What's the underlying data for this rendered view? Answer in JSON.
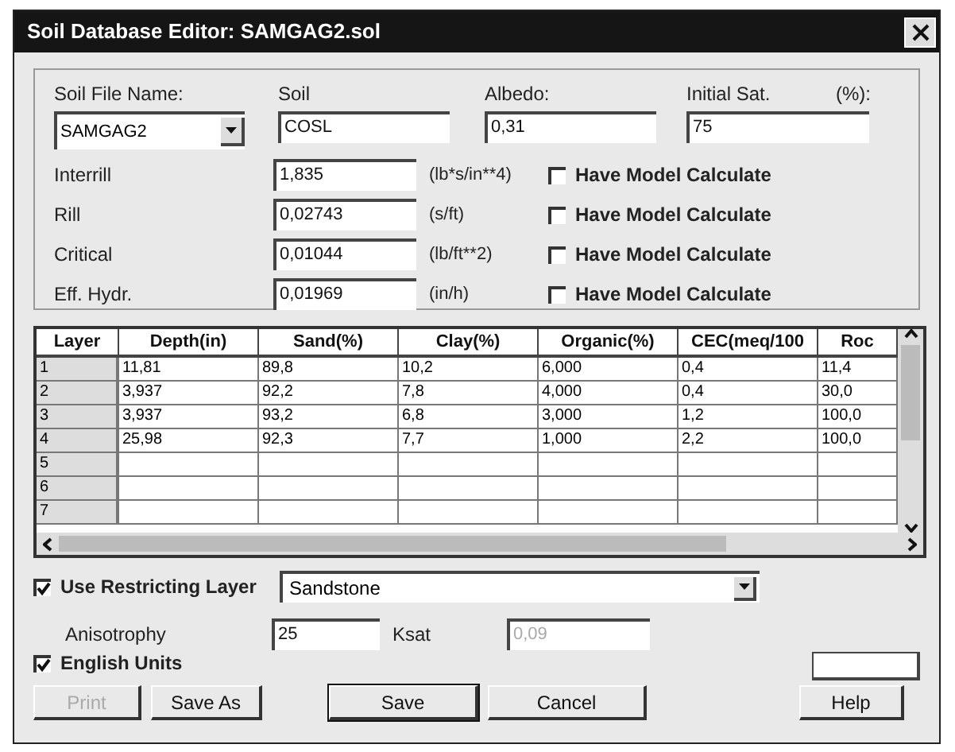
{
  "window": {
    "title": "Soil Database Editor: SAMGAG2.sol"
  },
  "header_fields": [
    {
      "label": "Soil File Name:",
      "value": "SAMGAG2",
      "kind": "dropdown"
    },
    {
      "label": "Soil",
      "value": "COSL",
      "kind": "text"
    },
    {
      "label": "Albedo:",
      "value": "0,31",
      "kind": "text"
    },
    {
      "label": "Initial Sat.",
      "unit": "(%):",
      "value": "75",
      "kind": "text"
    }
  ],
  "parameters": [
    {
      "label": "Interrill",
      "value": "1,835",
      "unit": "(lb*s/in**4)",
      "checkbox": "Have Model Calculate",
      "checked": false
    },
    {
      "label": "Rill",
      "value": "0,02743",
      "unit": "(s/ft)",
      "checkbox": "Have Model Calculate",
      "checked": false
    },
    {
      "label": "Critical",
      "value": "0,01044",
      "unit": "(lb/ft**2)",
      "checkbox": "Have Model Calculate",
      "checked": false
    },
    {
      "label": "Eff. Hydr.",
      "value": "0,01969",
      "unit": "(in/h)",
      "checkbox": "Have Model Calculate",
      "checked": false
    }
  ],
  "table": {
    "columns": [
      "Layer",
      "Depth(in)",
      "Sand(%)",
      "Clay(%)",
      "Organic(%)",
      "CEC(meq/100",
      "Roc"
    ],
    "rows": [
      [
        "1",
        "11,81",
        "89,8",
        "10,2",
        "6,000",
        "0,4",
        "11,4"
      ],
      [
        "2",
        "3,937",
        "92,2",
        "7,8",
        "4,000",
        "0,4",
        "30,0"
      ],
      [
        "3",
        "3,937",
        "93,2",
        "6,8",
        "3,000",
        "1,2",
        "100,0"
      ],
      [
        "4",
        "25,98",
        "92,3",
        "7,7",
        "1,000",
        "2,2",
        "100,0"
      ],
      [
        "5",
        "",
        "",
        "",
        "",
        "",
        ""
      ],
      [
        "6",
        "",
        "",
        "",
        "",
        "",
        ""
      ],
      [
        "7",
        "",
        "",
        "",
        "",
        "",
        ""
      ]
    ]
  },
  "restricting_layer": {
    "label": "Use Restricting Layer",
    "checked": true,
    "value": "Sandstone"
  },
  "anisotrophy": {
    "label": "Anisotrophy",
    "value": "25"
  },
  "ksat": {
    "label": "Ksat",
    "value": "0,09",
    "disabled": true
  },
  "english_units": {
    "label": "English Units",
    "checked": true
  },
  "buttons": [
    {
      "label": "Print",
      "disabled": true
    },
    {
      "label": "Save As",
      "disabled": false
    },
    {
      "label": "Save",
      "disabled": false,
      "default": true
    },
    {
      "label": "Cancel",
      "disabled": false
    },
    {
      "label": "Help",
      "disabled": false
    }
  ]
}
